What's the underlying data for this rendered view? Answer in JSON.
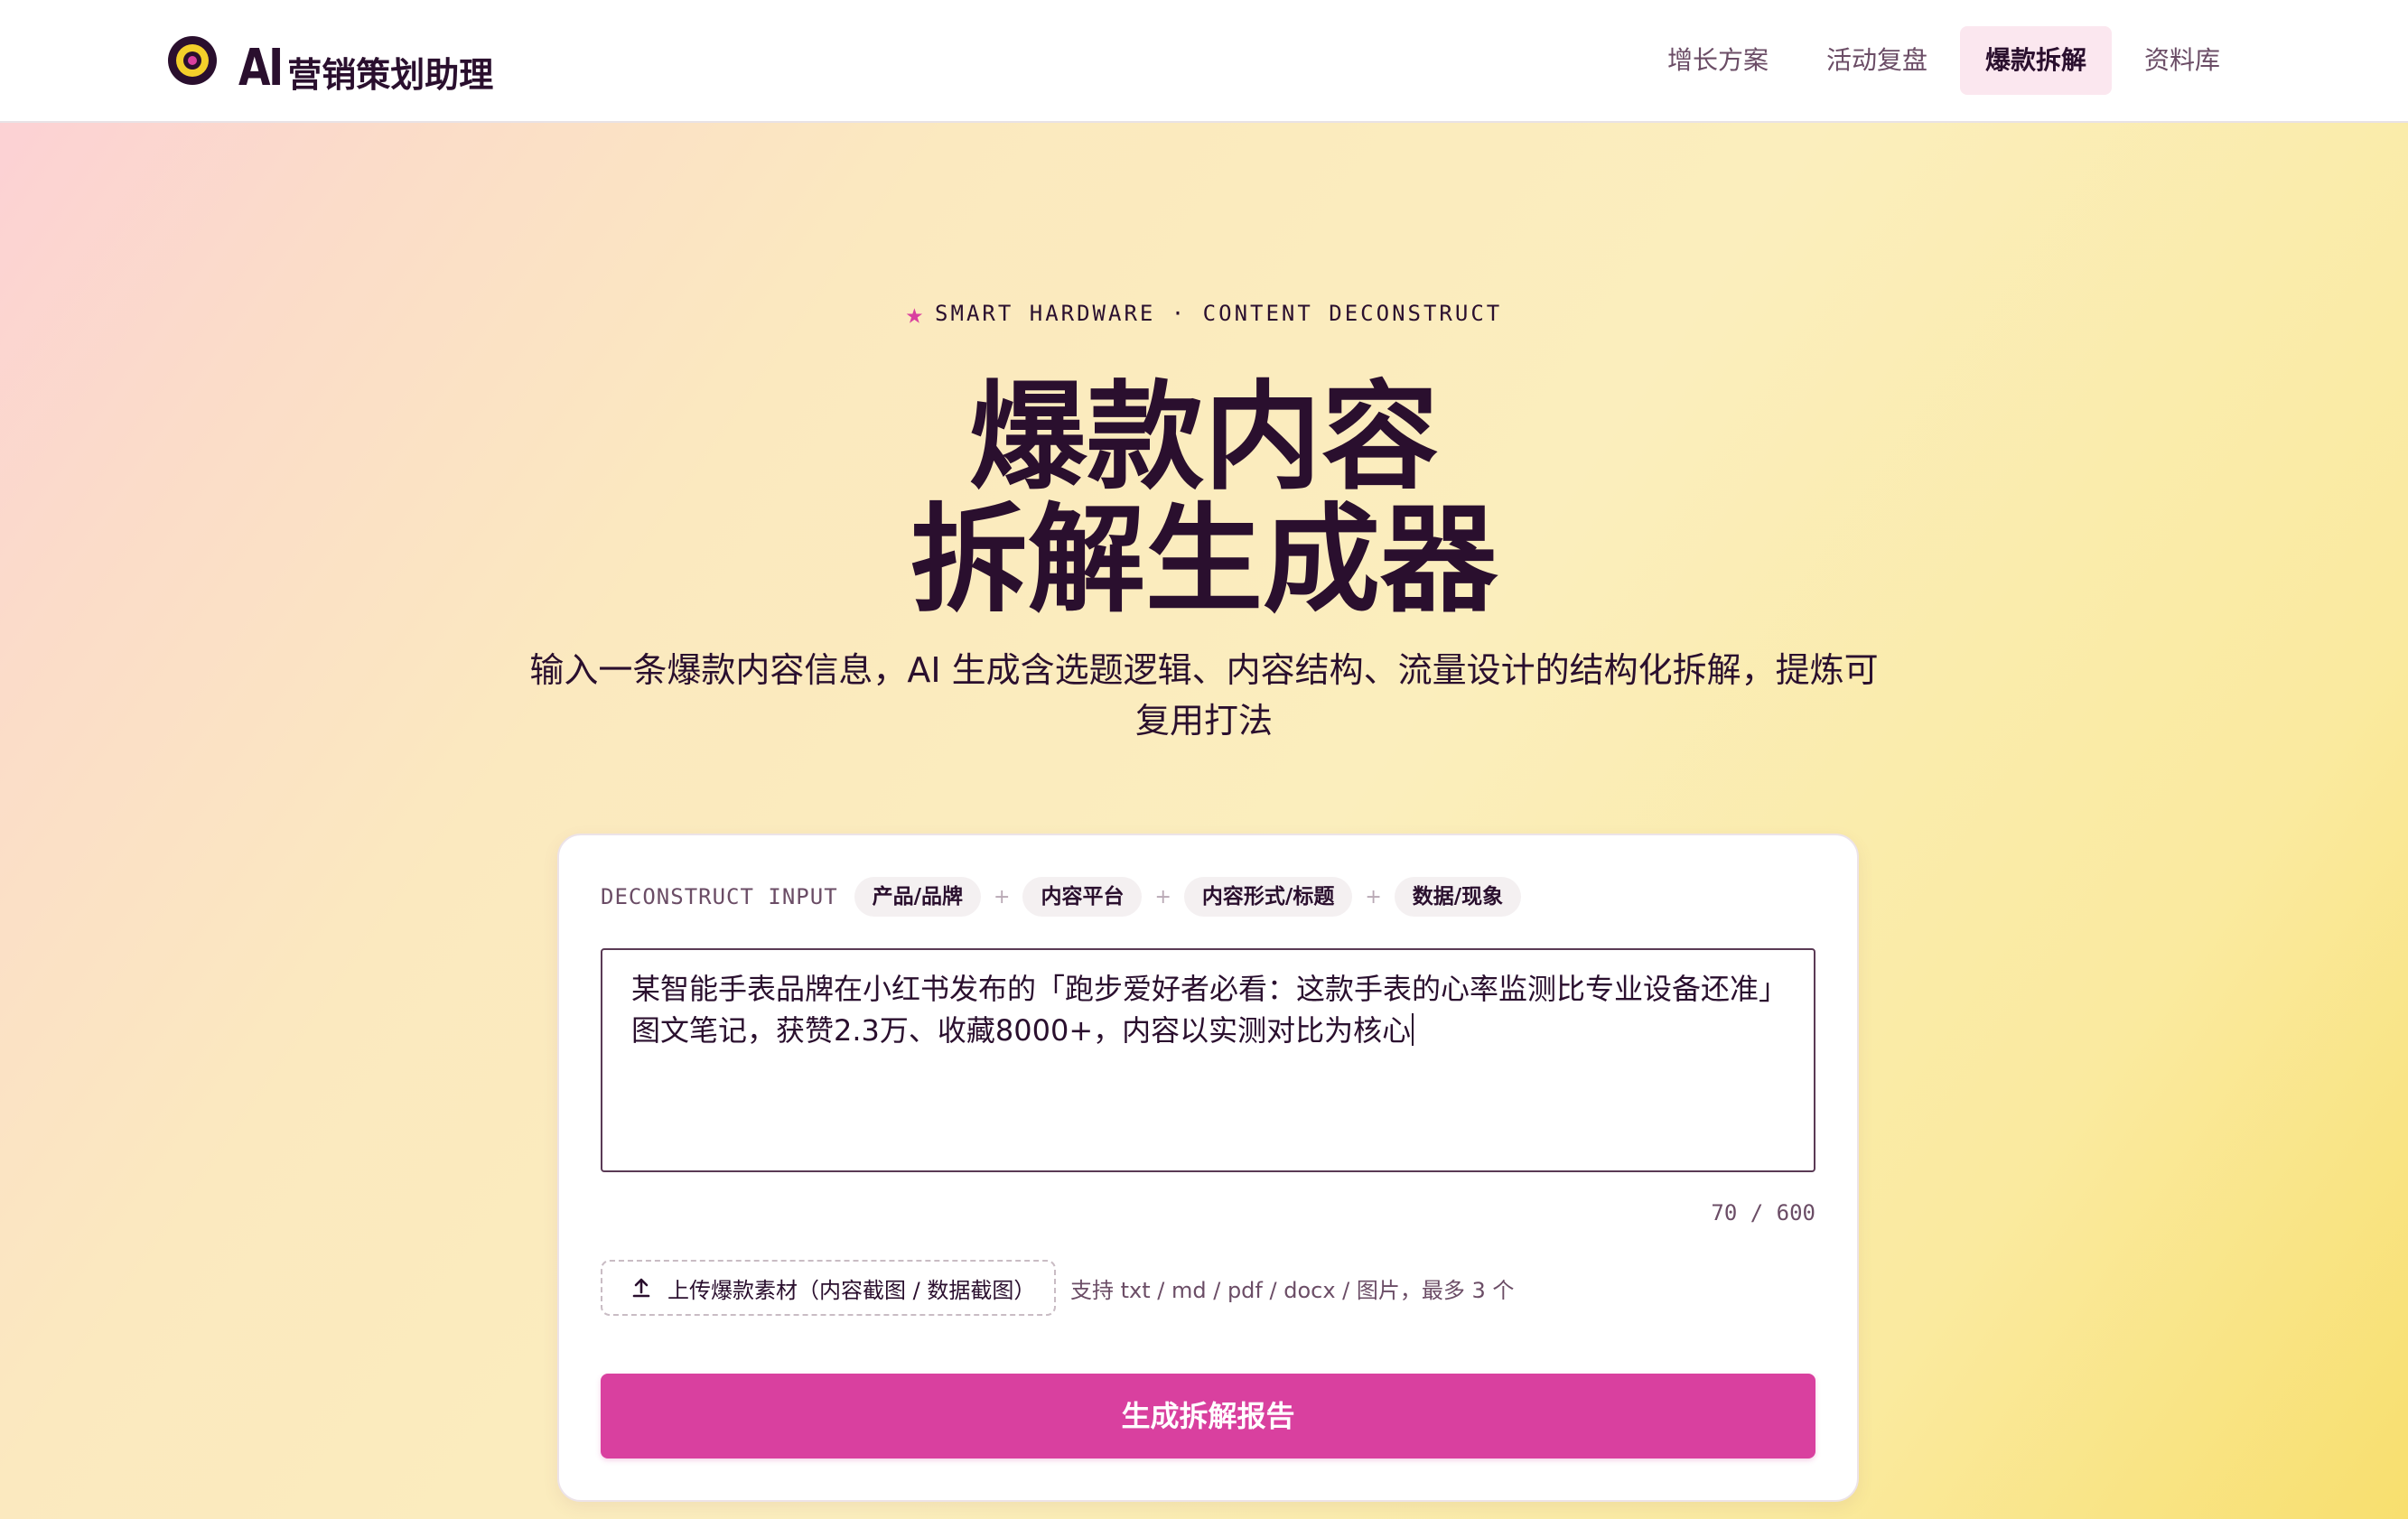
{
  "header": {
    "brand_ai": "AI",
    "brand_name": "营销策划助理",
    "nav": [
      {
        "label": "增长方案",
        "active": false
      },
      {
        "label": "活动复盘",
        "active": false
      },
      {
        "label": "爆款拆解",
        "active": true
      },
      {
        "label": "资料库",
        "active": false
      }
    ]
  },
  "hero": {
    "eyebrow": "SMART HARDWARE · CONTENT DECONSTRUCT",
    "title_line1": "爆款内容",
    "title_line2": "拆解生成器",
    "subtitle": "输入一条爆款内容信息，AI 生成含选题逻辑、内容结构、流量设计的结构化拆解，提炼可复用打法"
  },
  "form": {
    "input_label": "DECONSTRUCT INPUT",
    "chips": [
      "产品/品牌",
      "内容平台",
      "内容形式/标题",
      "数据/现象"
    ],
    "plus": "+",
    "textarea_value": "某智能手表品牌在小红书发布的「跑步爱好者必看：这款手表的心率监测比专业设备还准」图文笔记，获赞2.3万、收藏8000+，内容以实测对比为核心",
    "counter": "70 / 600",
    "upload_label": "上传爆款素材（内容截图 / 数据截图）",
    "upload_hint": "支持 txt / md / pdf / docx / 图片，最多 3 个",
    "submit_label": "生成拆解报告"
  },
  "colors": {
    "accent": "#d9409f",
    "ink": "#2a0f2e",
    "muted": "#6b4d66",
    "logo_yellow": "#f3cf2a",
    "nav_active_bg": "#fbe7ef"
  },
  "icons": [
    "logo-target-icon",
    "star-icon",
    "upload-icon"
  ]
}
